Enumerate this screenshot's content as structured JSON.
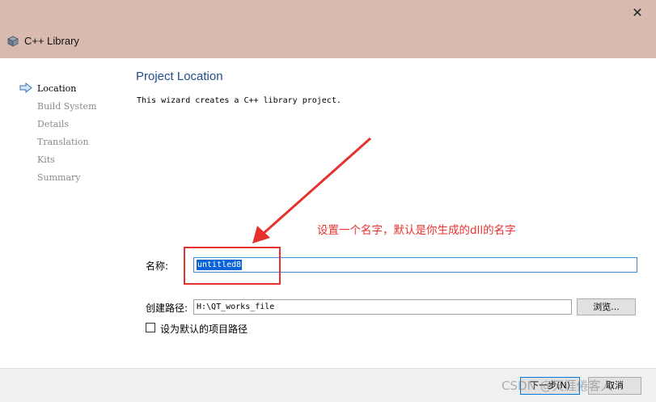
{
  "window": {
    "title": "C++ Library",
    "close_glyph": "✕",
    "title_icon": "cube-icon",
    "titlebar_color": "#d8bbae"
  },
  "sidebar": {
    "steps": [
      {
        "label": "Location",
        "active": true
      },
      {
        "label": "Build System",
        "active": false
      },
      {
        "label": "Details",
        "active": false
      },
      {
        "label": "Translation",
        "active": false
      },
      {
        "label": "Kits",
        "active": false
      },
      {
        "label": "Summary",
        "active": false
      }
    ],
    "active_icon": "arrow-right-icon"
  },
  "main": {
    "title": "Project Location",
    "subtitle": "This wizard creates a C++ library project.",
    "name_label": "名称:",
    "name_value": "untitled8",
    "path_label": "创建路径:",
    "path_value": "H:\\QT_works_file",
    "browse_label": "浏览...",
    "default_path_label": "设为默认的项目路径",
    "default_path_checked": false
  },
  "annotation": {
    "text": "设置一个名字，默认是你生成的dll的名字",
    "color": "#e6322e"
  },
  "footer": {
    "next_label": "下一步(N)",
    "cancel_label": "取消"
  },
  "watermark": "CSDN @天涯倦客人"
}
